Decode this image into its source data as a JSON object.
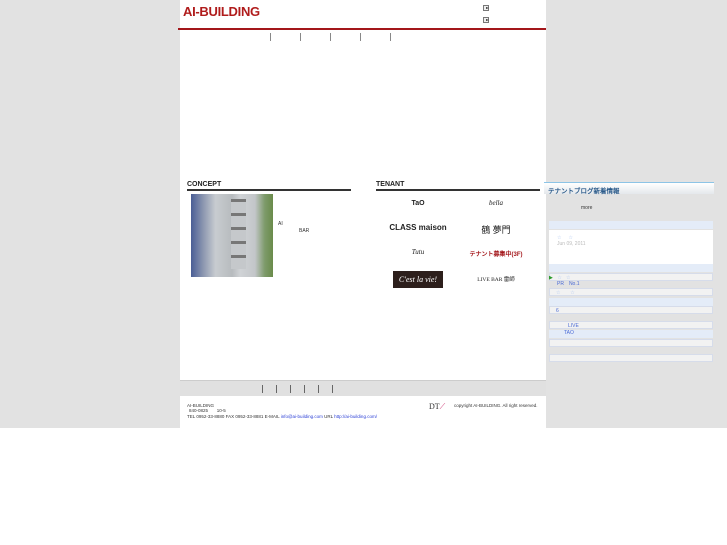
{
  "header": {
    "logo": "AI-BUILDING",
    "links": [
      "",
      ""
    ]
  },
  "nav": [
    "",
    "",
    "",
    "",
    "",
    ""
  ],
  "concept": {
    "title": "CONCEPT",
    "text1": "AI",
    "text2": "BAR"
  },
  "tenant": {
    "title": "TENANT",
    "items": [
      "TaO",
      "bella",
      "CLASS maison",
      "鶴 夢門",
      "Tutu",
      "テナント募集中(3F)",
      "C'est la vie!",
      "LIVE BAR 雷師"
    ]
  },
  "sidebar": {
    "title": "テナントブログ新着情報",
    "more": "more",
    "date": "Jun 09, 2011",
    "pr": "PR　No.1",
    "n6": "6",
    "live": "LIVE",
    "tao": "TAO"
  },
  "footer": {
    "name": "AI-BUILDING",
    "addr1": "840-0825",
    "addr2": "10-5",
    "contact": "TEL 0952-33-8880 FAX 0952-33-8881 E-MAIL ",
    "email": "info@ai-building.com",
    "url_label": " URL ",
    "url": "http://ai-building.com/",
    "copyright": "copyright AI-BUILDING. All right reserved."
  }
}
